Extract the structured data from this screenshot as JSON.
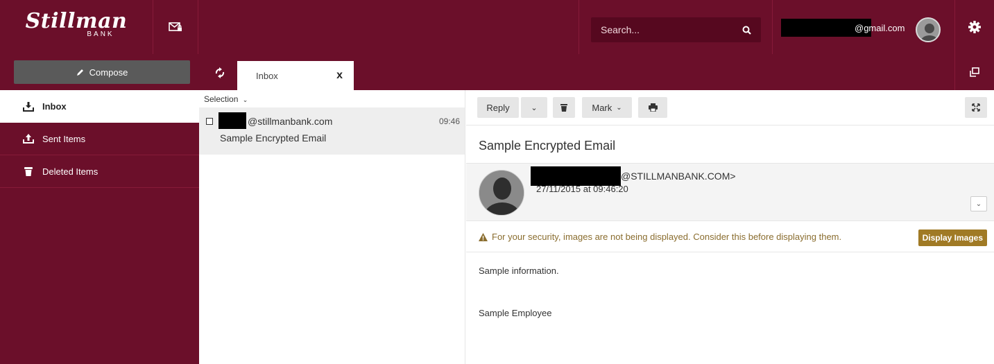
{
  "brand": {
    "name": "Stillman",
    "sub": "BANK"
  },
  "icons": {
    "mail": "mail-lock-icon",
    "search": "search-icon",
    "gear": "gear-icon",
    "refresh": "refresh-icon",
    "popout": "popout-icon",
    "compose": "pencil-icon",
    "inbox": "inbox-icon",
    "sent": "sent-icon",
    "deleted": "trash-icon",
    "print": "print-icon",
    "expand": "expand-icon",
    "warning": "warning-icon"
  },
  "colors": {
    "primary": "#6b0f2a",
    "search_bg": "#56081f",
    "compose_bg": "#5a5a5a",
    "warning_text": "#8a6d2f",
    "display_btn": "#a07a25"
  },
  "search": {
    "placeholder": "Search..."
  },
  "user": {
    "email_suffix": "@gmail.com"
  },
  "compose": {
    "label": "Compose"
  },
  "tabs": [
    {
      "label": "Inbox",
      "close": "x"
    }
  ],
  "sidebar": {
    "items": [
      {
        "label": "Inbox",
        "active": true
      },
      {
        "label": "Sent Items",
        "active": false
      },
      {
        "label": "Deleted Items",
        "active": false
      }
    ]
  },
  "list": {
    "selection_label": "Selection",
    "messages": [
      {
        "sender_suffix": "@stillmanbank.com",
        "time": "09:46",
        "subject": "Sample Encrypted Email"
      }
    ]
  },
  "reader": {
    "toolbar": {
      "reply": "Reply",
      "mark": "Mark"
    },
    "subject": "Sample Encrypted Email",
    "from_suffix": "@STILLMANBANK.COM>",
    "date": "27/11/2015 at 09:46:20",
    "warning": "For your security, images are not being displayed. Consider this before displaying them.",
    "display_images": "Display Images",
    "body": [
      "Sample information.",
      "Sample Employee"
    ]
  }
}
